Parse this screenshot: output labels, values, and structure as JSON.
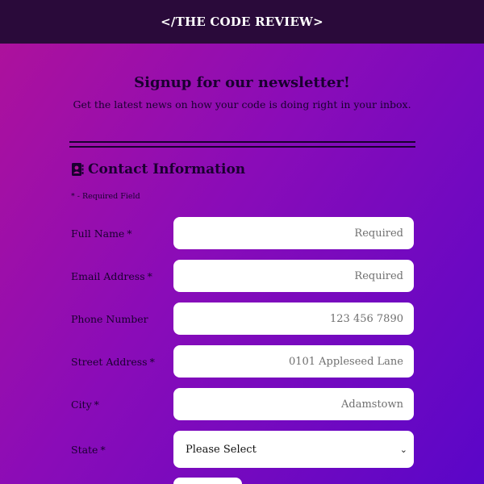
{
  "header": {
    "brand": "</THE CODE REVIEW>"
  },
  "hero": {
    "title": "Signup for our newsletter!",
    "subtitle": "Get the latest news on how your code is doing right in your inbox."
  },
  "section": {
    "title": "Contact Information",
    "icon": "address-book-icon",
    "required_note": "* - Required Field"
  },
  "fields": [
    {
      "label": "Full Name",
      "required_mark": "*",
      "placeholder": "Required"
    },
    {
      "label": "Email Address",
      "required_mark": "*",
      "placeholder": "Required"
    },
    {
      "label": "Phone Number",
      "required_mark": "",
      "placeholder": "123 456 7890"
    },
    {
      "label": "Street Address",
      "required_mark": "*",
      "placeholder": "0101 Appleseed Lane"
    },
    {
      "label": "City",
      "required_mark": "*",
      "placeholder": "Adamstown"
    }
  ],
  "state": {
    "label": "State",
    "required_mark": "*",
    "selected": "Please Select",
    "chevron": "⌄"
  },
  "colors": {
    "header_bg": "#2a0a3a",
    "gradient_start": "#b0129a",
    "gradient_end": "#5a06c8"
  }
}
